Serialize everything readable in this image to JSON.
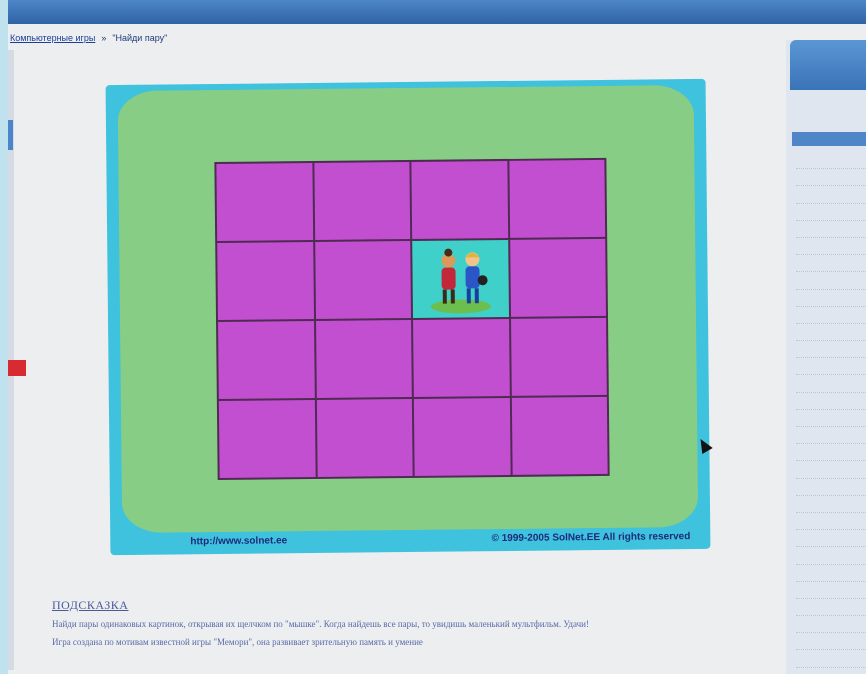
{
  "breadcrumb": {
    "parent": "Компьютерные игры",
    "separator": "»",
    "current": "\"Найди пару\""
  },
  "game": {
    "rows": 4,
    "cols": 4,
    "open_card_index": 6,
    "footer_url": "http://www.solnet.ee",
    "footer_copyright": "© 1999-2005 SolNet.EE  All rights reserved"
  },
  "hint": {
    "title": "ПОДСКАЗКА",
    "text": "Найди пары одинаковых картинок, открывая их щелчком по \"мышке\". Когда найдешь все пары, то увидишь маленький мультфильм. Удачи!",
    "text2": "Игра создана по мотивам известной игры \"Мемори\", она развивает зрительную память и умение"
  },
  "colors": {
    "frame": "#3ec2dd",
    "field": "#88cd85",
    "card_back": "#c24fd0",
    "card_open": "#3fd0c9"
  }
}
